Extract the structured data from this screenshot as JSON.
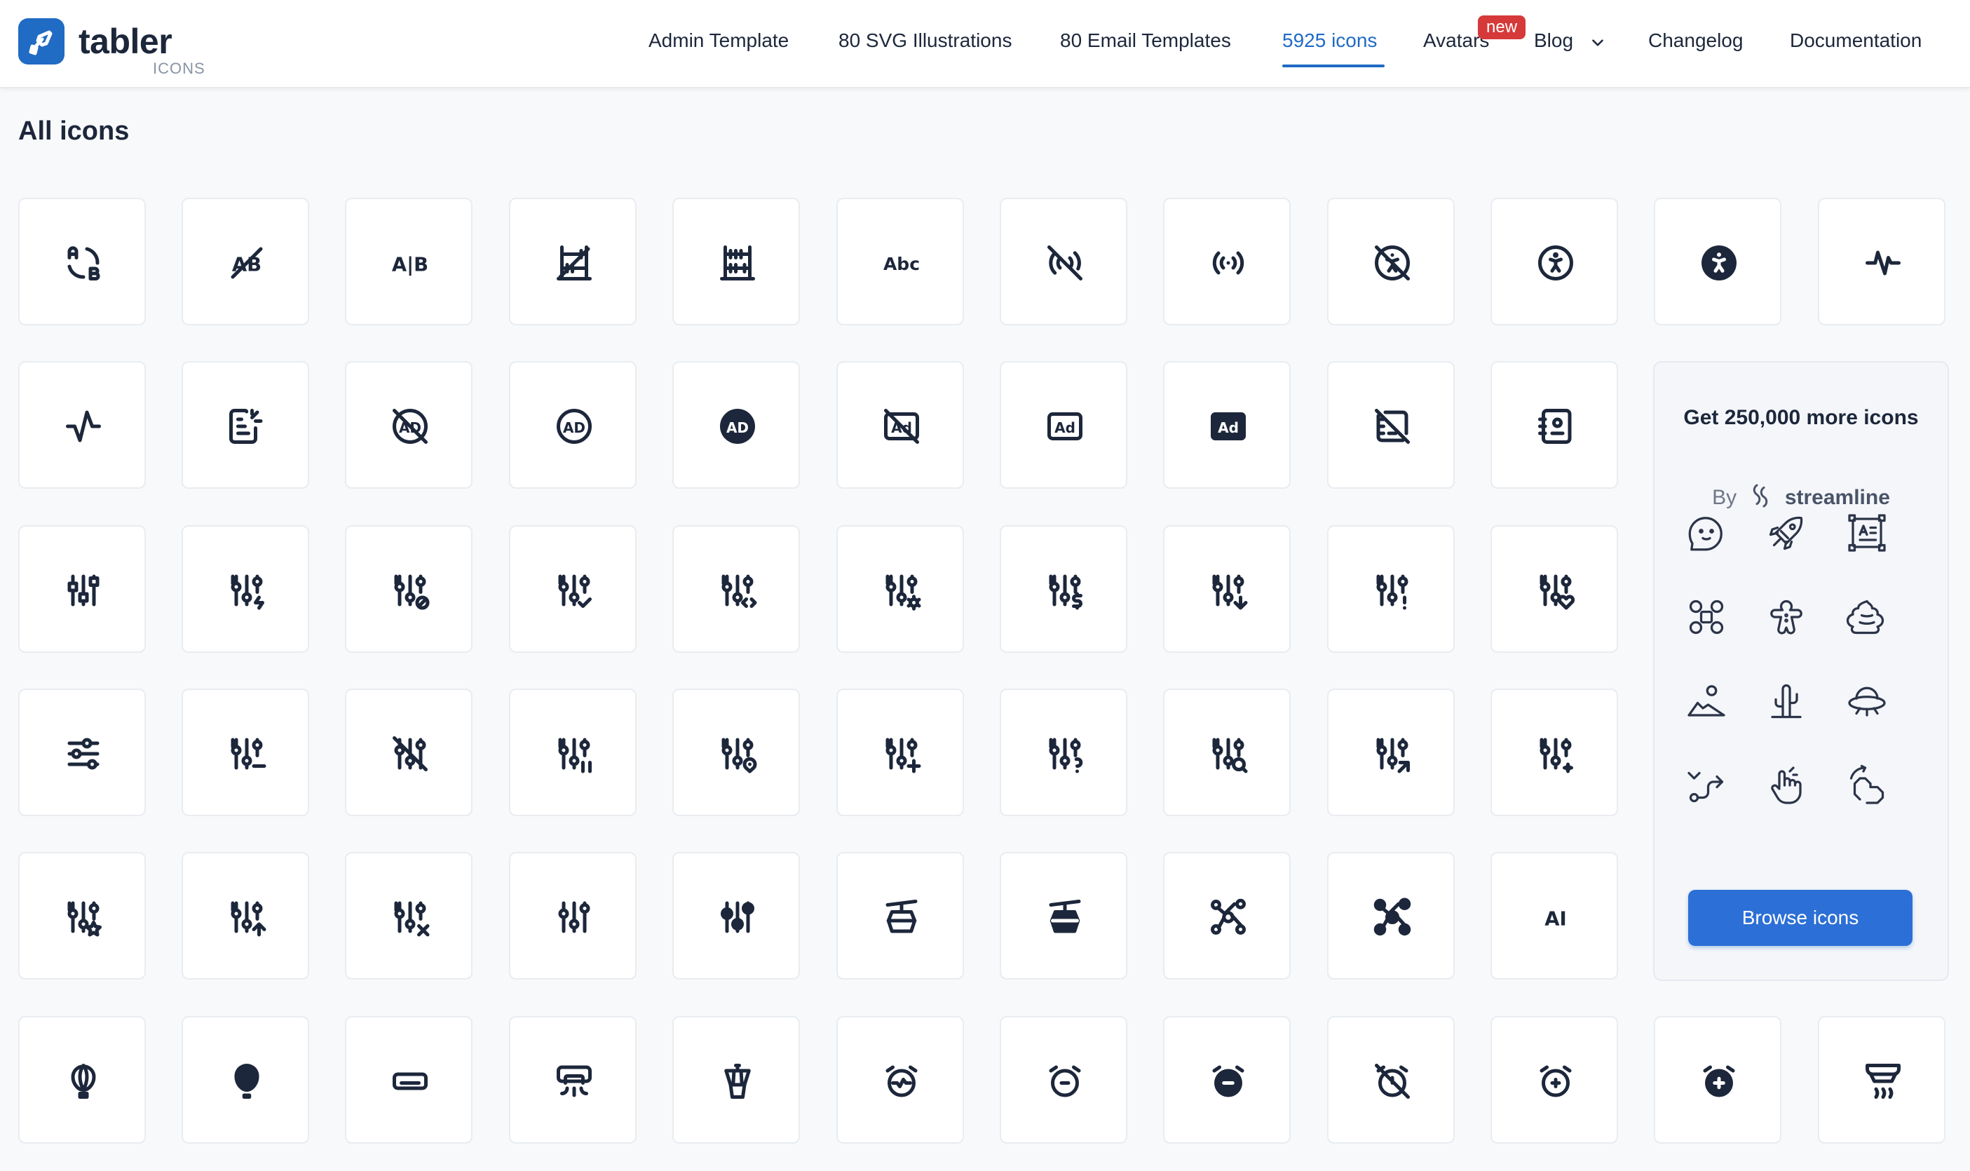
{
  "brand": {
    "name": "tabler",
    "sub": "ICONS"
  },
  "nav": {
    "admin": "Admin Template",
    "illustrations": "80 SVG Illustrations",
    "email": "80 Email Templates",
    "icons": "5925 icons",
    "avatars": "Avatars",
    "avatars_badge": "new",
    "blog": "Blog",
    "changelog": "Changelog",
    "docs": "Documentation"
  },
  "page": {
    "title": "All icons"
  },
  "icon_rows": [
    [
      "a-b-2",
      "a-b-off",
      "a-b",
      "abacus-off",
      "abacus",
      "abc",
      "access-point-off",
      "access-point",
      "accessible-off",
      "accessible",
      "accessible-filled",
      "activity-heartbeat"
    ],
    [
      "activity",
      "ad-2",
      "ad-off",
      "ad-circle",
      "ad-circle-filled",
      "ad-off-2",
      "ad",
      "ad-filled",
      "address-book-off",
      "address-book"
    ],
    [
      "adjustments-alt",
      "adjustments-bolt",
      "adjustments-cancel",
      "adjustments-check",
      "adjustments-code",
      "adjustments-cog",
      "adjustments-dollar",
      "adjustments-down",
      "adjustments-exclamation",
      "adjustments-heart"
    ],
    [
      "adjustments-horizontal",
      "adjustments-minus",
      "adjustments-off",
      "adjustments-pause",
      "adjustments-pin",
      "adjustments-plus",
      "adjustments-question",
      "adjustments-search",
      "adjustments-share",
      "adjustments-spark"
    ],
    [
      "adjustments-star",
      "adjustments-up",
      "adjustments-x",
      "adjustments",
      "adjustments-filled",
      "aerial-lift",
      "aerial-lift-filled",
      "affiliate",
      "affiliate-filled",
      "ai"
    ],
    [
      "air-balloon",
      "air-balloon-filled",
      "air-conditioning-disabled",
      "air-conditioning",
      "air-traffic-control",
      "alarm-average",
      "alarm-minus",
      "alarm-minus-filled",
      "alarm-off",
      "alarm-plus",
      "alarm-plus-filled",
      "alarm-smoke"
    ]
  ],
  "icon_text": {
    "abc": "Abc",
    "ad": "AD",
    "ad_sq": "Ad",
    "ai": "AI",
    "ab": "A|B"
  },
  "promo": {
    "title": "Get 250,000 more icons",
    "by": "By",
    "brand": "streamline",
    "button": "Browse icons",
    "icons": [
      "chat-face-icon",
      "rocket-icon",
      "id-card-icon",
      "drone-icon",
      "gingerbread-icon",
      "poop-icon",
      "landscape-icon",
      "cactus-icon",
      "ufo-icon",
      "route-icon",
      "hand-gesture-icon",
      "hand-rotate-icon"
    ]
  },
  "colors": {
    "accent": "#206bc4",
    "ink": "#1d273b",
    "badge": "#d63939",
    "button": "#2c6fd6"
  }
}
